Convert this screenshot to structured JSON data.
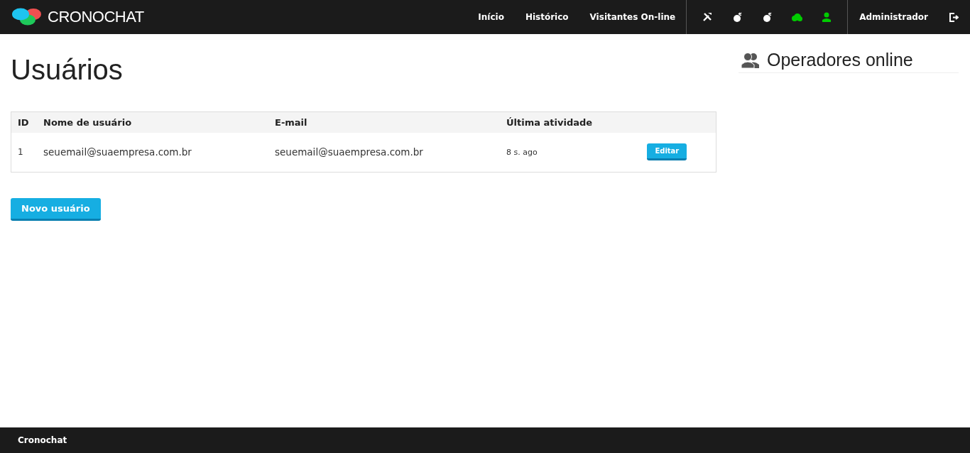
{
  "brand": "CRONOCHAT",
  "nav": [
    {
      "label": "Início"
    },
    {
      "label": "Histórico"
    },
    {
      "label": "Visitantes On-line"
    }
  ],
  "status_icons": [
    {
      "kind": "tools",
      "color": "#ffffff"
    },
    {
      "kind": "mouse",
      "color": "#ffffff"
    },
    {
      "kind": "mouse",
      "color": "#ffffff"
    },
    {
      "kind": "cloud",
      "color": "#00cc00"
    },
    {
      "kind": "user",
      "color": "#00cc00"
    }
  ],
  "user": "Administrador",
  "title": "Usuários",
  "table": {
    "columns": [
      "ID",
      "Nome de usuário",
      "E-mail",
      "Última atividade"
    ],
    "rows": [
      {
        "id": "1",
        "username": "seuemail@suaempresa.com.br",
        "email": "seuemail@suaempresa.com.br",
        "activity": "8 s. ago",
        "action": "Editar"
      }
    ]
  },
  "new_button": "Novo usuário",
  "sidebar": {
    "title": "Operadores online"
  },
  "footer": "Cronochat"
}
